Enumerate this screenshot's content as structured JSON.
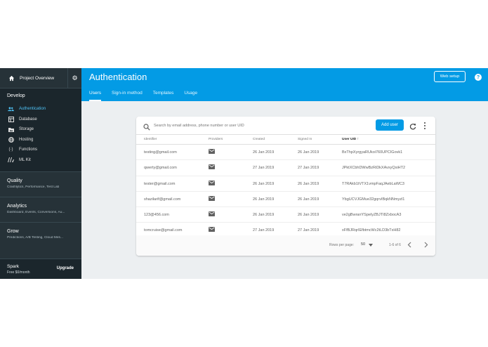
{
  "sidebar": {
    "project_title": "Project Overview",
    "develop_label": "Develop",
    "items": [
      {
        "label": "Authentication",
        "icon": "users-icon"
      },
      {
        "label": "Database",
        "icon": "database-icon"
      },
      {
        "label": "Storage",
        "icon": "storage-icon"
      },
      {
        "label": "Hosting",
        "icon": "globe-icon"
      },
      {
        "label": "Functions",
        "icon": "functions-icon"
      },
      {
        "label": "ML Kit",
        "icon": "mlkit-icon"
      }
    ],
    "sections": [
      {
        "title": "Quality",
        "subtitle": "Crashlytics, Performance, Test Lab"
      },
      {
        "title": "Analytics",
        "subtitle": "Dashboard, Events, Conversions, Au..."
      },
      {
        "title": "Grow",
        "subtitle": "Predictions, A/B Testing, Cloud Mes..."
      }
    ],
    "plan": {
      "name": "Spark",
      "price": "Free $0/month",
      "upgrade_label": "Upgrade"
    }
  },
  "header": {
    "title": "Authentication",
    "web_setup_label": "Web setup",
    "help_label": "?",
    "tabs": [
      {
        "label": "Users",
        "active": true
      },
      {
        "label": "Sign-in method",
        "active": false
      },
      {
        "label": "Templates",
        "active": false
      },
      {
        "label": "Usage",
        "active": false
      }
    ]
  },
  "users": {
    "search_placeholder": "Search by email address, phone number or user UID",
    "add_user_label": "Add user",
    "columns": [
      "Identifier",
      "Providers",
      "Created",
      "Signed In",
      "User UID"
    ],
    "sort_indicator": "↑",
    "rows": [
      {
        "identifier": "testing@gmail.com",
        "provider": "mail-icon",
        "created": "26 Jan 2019",
        "signed_in": "26 Jan 2019",
        "uid": "BxThpXyrgyaRUkoi760UPCIGovk1"
      },
      {
        "identifier": "qwerty@gmail.com",
        "provider": "mail-icon",
        "created": "27 Jan 2019",
        "signed_in": "27 Jan 2019",
        "uid": "JPktXCbhDWwBzRiDkXAvxyQsiHT2"
      },
      {
        "identifier": "tester@gmail.com",
        "provider": "mail-icon",
        "created": "26 Jan 2019",
        "signed_in": "26 Jan 2019",
        "uid": "T7RAkb1tVTX1vmpFaqJAebLaWC3"
      },
      {
        "identifier": "shazilarif@gmail.com",
        "provider": "mail-icon",
        "created": "26 Jan 2019",
        "signed_in": "26 Jan 2019",
        "uid": "YbgUCVJGMue32gqrvIBqkNNmyzl1"
      },
      {
        "identifier": "123@456.com",
        "provider": "mail-icon",
        "created": "26 Jan 2019",
        "signed_in": "26 Jan 2019",
        "uid": "ve2gBwranYSpelyZBJTI8ZxbocA3"
      },
      {
        "identifier": "tomcruise@gmail.com",
        "provider": "mail-icon",
        "created": "27 Jan 2019",
        "signed_in": "27 Jan 2019",
        "uid": "xFfBJRqrIEfbtmcWc2tLD3bTxH82"
      }
    ],
    "pagination": {
      "rows_per_page_label": "Rows per page:",
      "rows_per_page": "50",
      "range": "1-6 of 6"
    }
  },
  "colors": {
    "accent": "#039be5",
    "sidebar_bg": "#263238",
    "active_nav": "#4fc3f7"
  }
}
